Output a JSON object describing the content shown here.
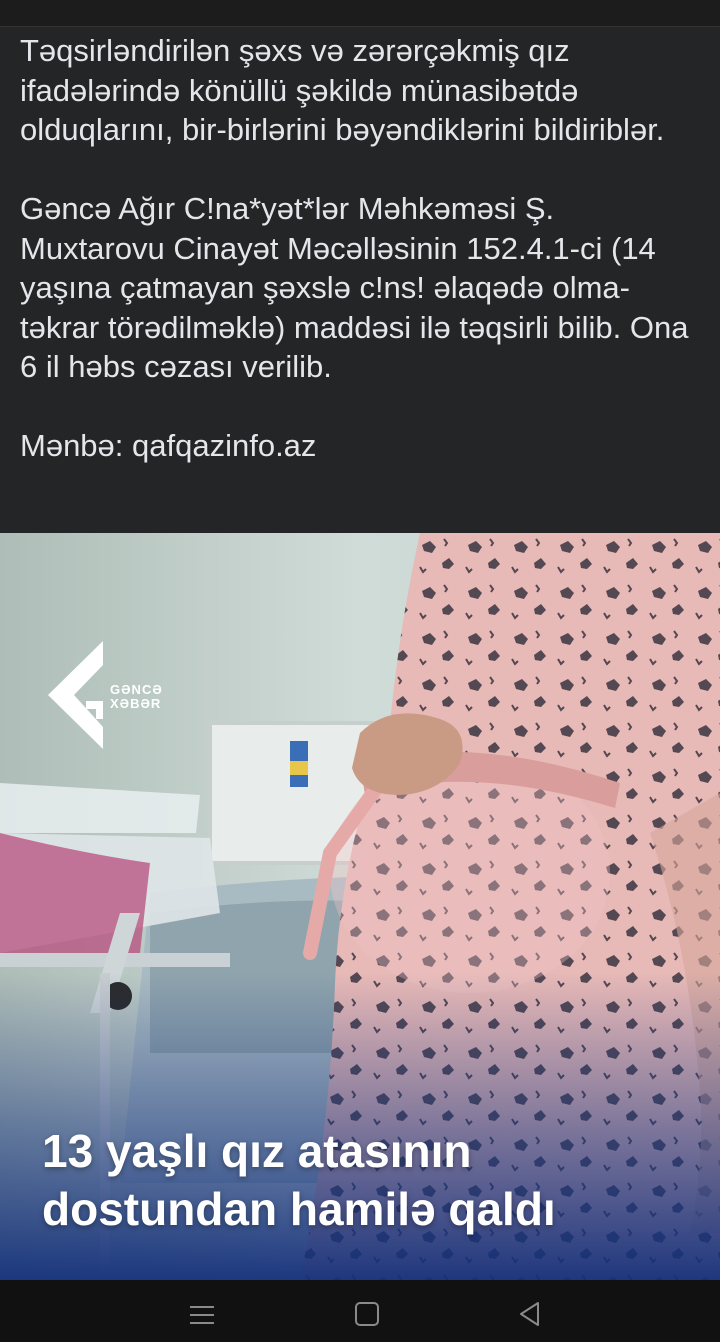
{
  "post": {
    "paragraphs": [
      "Təqsirləndirilən şəxs və zərərçəkmiş qız ifadələrində könüllü şəkildə münasibətdə olduqlarını, bir-birlərini bəyəndiklərini bildiriblər.",
      "Gəncə Ağır C!na*yət*lər Məhkəməsi Ş. Muxtarovu Cinayət Məcəlləsinin 152.4.1-ci (14 yaşına çatmayan şəxslə c!ns! əlaqədə olma-təkrar törədilməklə) maddəsi ilə təqsirli bilib. Ona 6 il həbs cəzası verilib.",
      "Mənbə: qafqazinfo.az"
    ]
  },
  "image": {
    "logo_line1": "GƏNCƏ",
    "logo_line2": "XƏBƏR",
    "headline_line1": "13 yaşlı qız atasının",
    "headline_line2": "dostundan hamilə qaldı"
  },
  "navbar": {
    "icons": [
      "menu-icon",
      "home-square-icon",
      "back-triangle-icon"
    ]
  },
  "colors": {
    "post_bg": "#242526",
    "text": "#e4e6eb",
    "gown": "#e7b9b7",
    "overlay": "#1c3a8a"
  }
}
